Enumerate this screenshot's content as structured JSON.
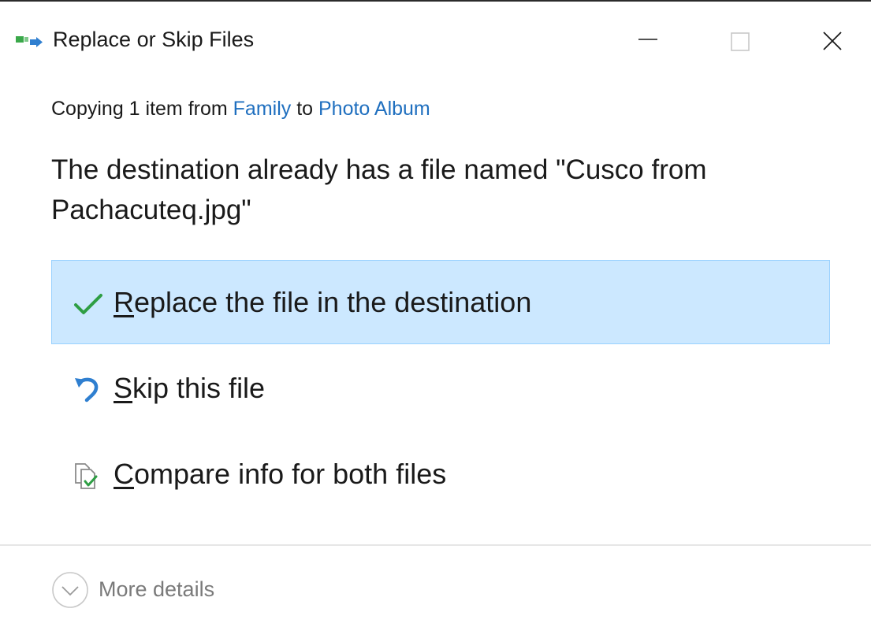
{
  "window": {
    "title": "Replace or Skip Files",
    "controls": {
      "minimize_icon": "minimize-icon",
      "maximize_icon": "maximize-icon",
      "close_icon": "close-icon"
    }
  },
  "copy_status": {
    "prefix": "Copying 1 item from ",
    "source": "Family",
    "middle": " to ",
    "destination": "Photo Album"
  },
  "message": "The destination already has a file named \"Cusco from Pachacuteq.jpg\"",
  "options": [
    {
      "accel": "R",
      "rest": "eplace the file in the destination",
      "icon": "checkmark-icon",
      "selected": true
    },
    {
      "accel": "S",
      "rest": "kip this file",
      "icon": "skip-undo-icon",
      "selected": false
    },
    {
      "accel": "C",
      "rest": "ompare info for both files",
      "icon": "compare-files-icon",
      "selected": false
    }
  ],
  "footer": {
    "more_details_label": "More details",
    "icon": "chevron-down-circle-icon"
  },
  "colors": {
    "link": "#1f6fbf",
    "selected_bg": "#cce8ff",
    "selected_border": "#99d1ff",
    "check_green": "#2e9e44",
    "skip_blue": "#2f7fd0"
  }
}
